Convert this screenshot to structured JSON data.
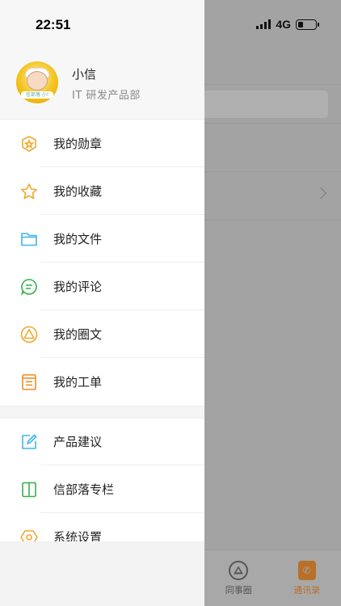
{
  "status_bar": {
    "time": "22:51",
    "network": "4G"
  },
  "profile": {
    "name": "小信",
    "department": "IT 研发产品部",
    "avatar_badge": "信部落 小!"
  },
  "menu_primary": [
    {
      "label": "我的勋章",
      "icon": "medal-icon",
      "color": "#F0A830"
    },
    {
      "label": "我的收藏",
      "icon": "star-icon",
      "color": "#F0A830"
    },
    {
      "label": "我的文件",
      "icon": "folder-icon",
      "color": "#3FB6E8"
    },
    {
      "label": "我的评论",
      "icon": "comment-icon",
      "color": "#35B04A"
    },
    {
      "label": "我的圈文",
      "icon": "circle-post-icon",
      "color": "#F0A830"
    },
    {
      "label": "我的工单",
      "icon": "ticket-icon",
      "color": "#F08A24"
    }
  ],
  "menu_secondary": [
    {
      "label": "产品建议",
      "icon": "edit-suggestion-icon",
      "color": "#3FB6E8"
    },
    {
      "label": "信部落专栏",
      "icon": "column-icon",
      "color": "#35B04A"
    },
    {
      "label": "系统设置",
      "icon": "settings-icon",
      "color": "#F0A830"
    }
  ],
  "background_tabbar": [
    {
      "label": "同事圈",
      "icon": "colleague-circle-icon",
      "active": false
    },
    {
      "label": "通讯录",
      "icon": "contacts-icon",
      "active": true
    }
  ],
  "colors": {
    "accent": "#B8702A",
    "overlay": "#A3A3A3"
  }
}
